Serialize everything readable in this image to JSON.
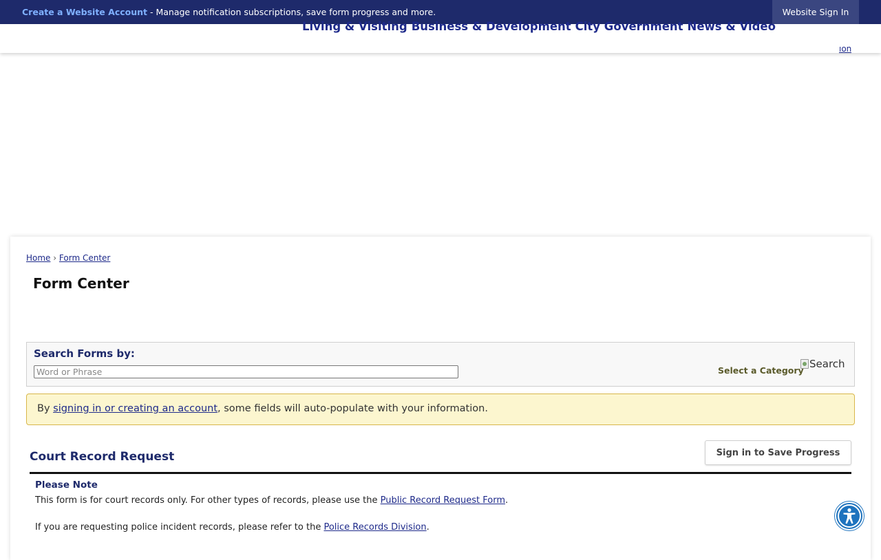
{
  "topbar": {
    "create_account_link": "Create a Website Account",
    "message": " - Manage notification subscriptions, save form progress and more.",
    "signin_button": "Website Sign In"
  },
  "nav": {
    "items": [
      "Living & Visiting",
      "Business & Development",
      "City Government",
      "News & Video"
    ],
    "fragment": "ion"
  },
  "breadcrumb": {
    "home": "Home",
    "separator": "›",
    "current": "Form Center"
  },
  "page_title": "Form Center",
  "search": {
    "label": "Search Forms by:",
    "placeholder": "Word or Phrase",
    "category_label": "Select a Category",
    "button_alt": "Search"
  },
  "notice": {
    "prefix": "By ",
    "link": "signing in or creating an account",
    "suffix": ", some fields will auto-populate with your information."
  },
  "form": {
    "title": "Court Record Request",
    "save_button": "Sign in to Save Progress",
    "note_heading": "Please Note",
    "p1_prefix": "This form is for court records only. For other types of records, please use the ",
    "p1_link": "Public Record Request Form",
    "p1_suffix": ".",
    "p2_prefix": "If you are requesting police incident records, please refer to the ",
    "p2_link": "Police Records Division",
    "p2_suffix": "."
  },
  "colors": {
    "topbar_bg": "#1e2a6b",
    "nav_text": "#1e2a8a",
    "notice_bg": "#fcf6cf",
    "accessibility_button": "#1e73be"
  },
  "icons": {
    "accessibility": "accessibility-icon",
    "broken_image": "broken-image-icon"
  }
}
